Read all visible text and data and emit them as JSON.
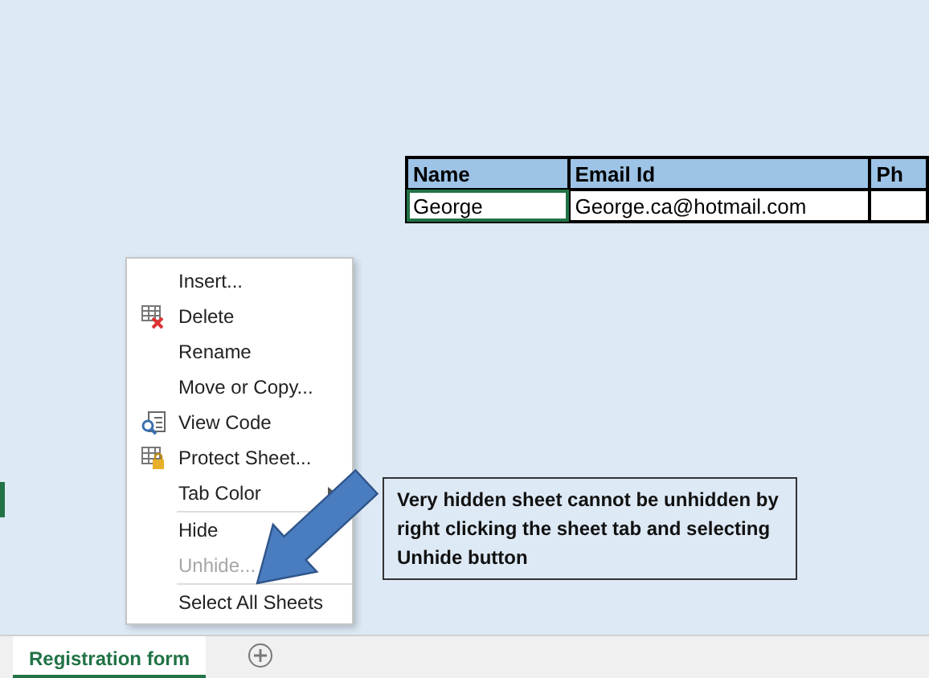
{
  "table": {
    "columns": [
      "Name",
      "Email Id",
      "Ph"
    ],
    "rows": [
      [
        "George",
        "George.ca@hotmail.com",
        ""
      ]
    ]
  },
  "context_menu": [
    {
      "kind": "item",
      "label": "Insert...",
      "disabled": false
    },
    {
      "kind": "item",
      "label": "Delete",
      "disabled": false
    },
    {
      "kind": "item",
      "label": "Rename",
      "disabled": false
    },
    {
      "kind": "item",
      "label": "Move or Copy...",
      "disabled": false
    },
    {
      "kind": "item",
      "label": "View Code",
      "disabled": false
    },
    {
      "kind": "item",
      "label": "Protect Sheet...",
      "disabled": false
    },
    {
      "kind": "submenu",
      "label": "Tab Color",
      "disabled": false
    },
    {
      "kind": "separator"
    },
    {
      "kind": "item",
      "label": "Hide",
      "disabled": false
    },
    {
      "kind": "item",
      "label": "Unhide...",
      "disabled": true
    },
    {
      "kind": "separator"
    },
    {
      "kind": "item",
      "label": "Select All Sheets",
      "disabled": false
    }
  ],
  "callout": "Very hidden sheet cannot be unhidden by  right clicking the sheet tab and selecting Unhide button",
  "sheet_tabs": [
    {
      "label": "Registration form",
      "selected": true
    }
  ]
}
